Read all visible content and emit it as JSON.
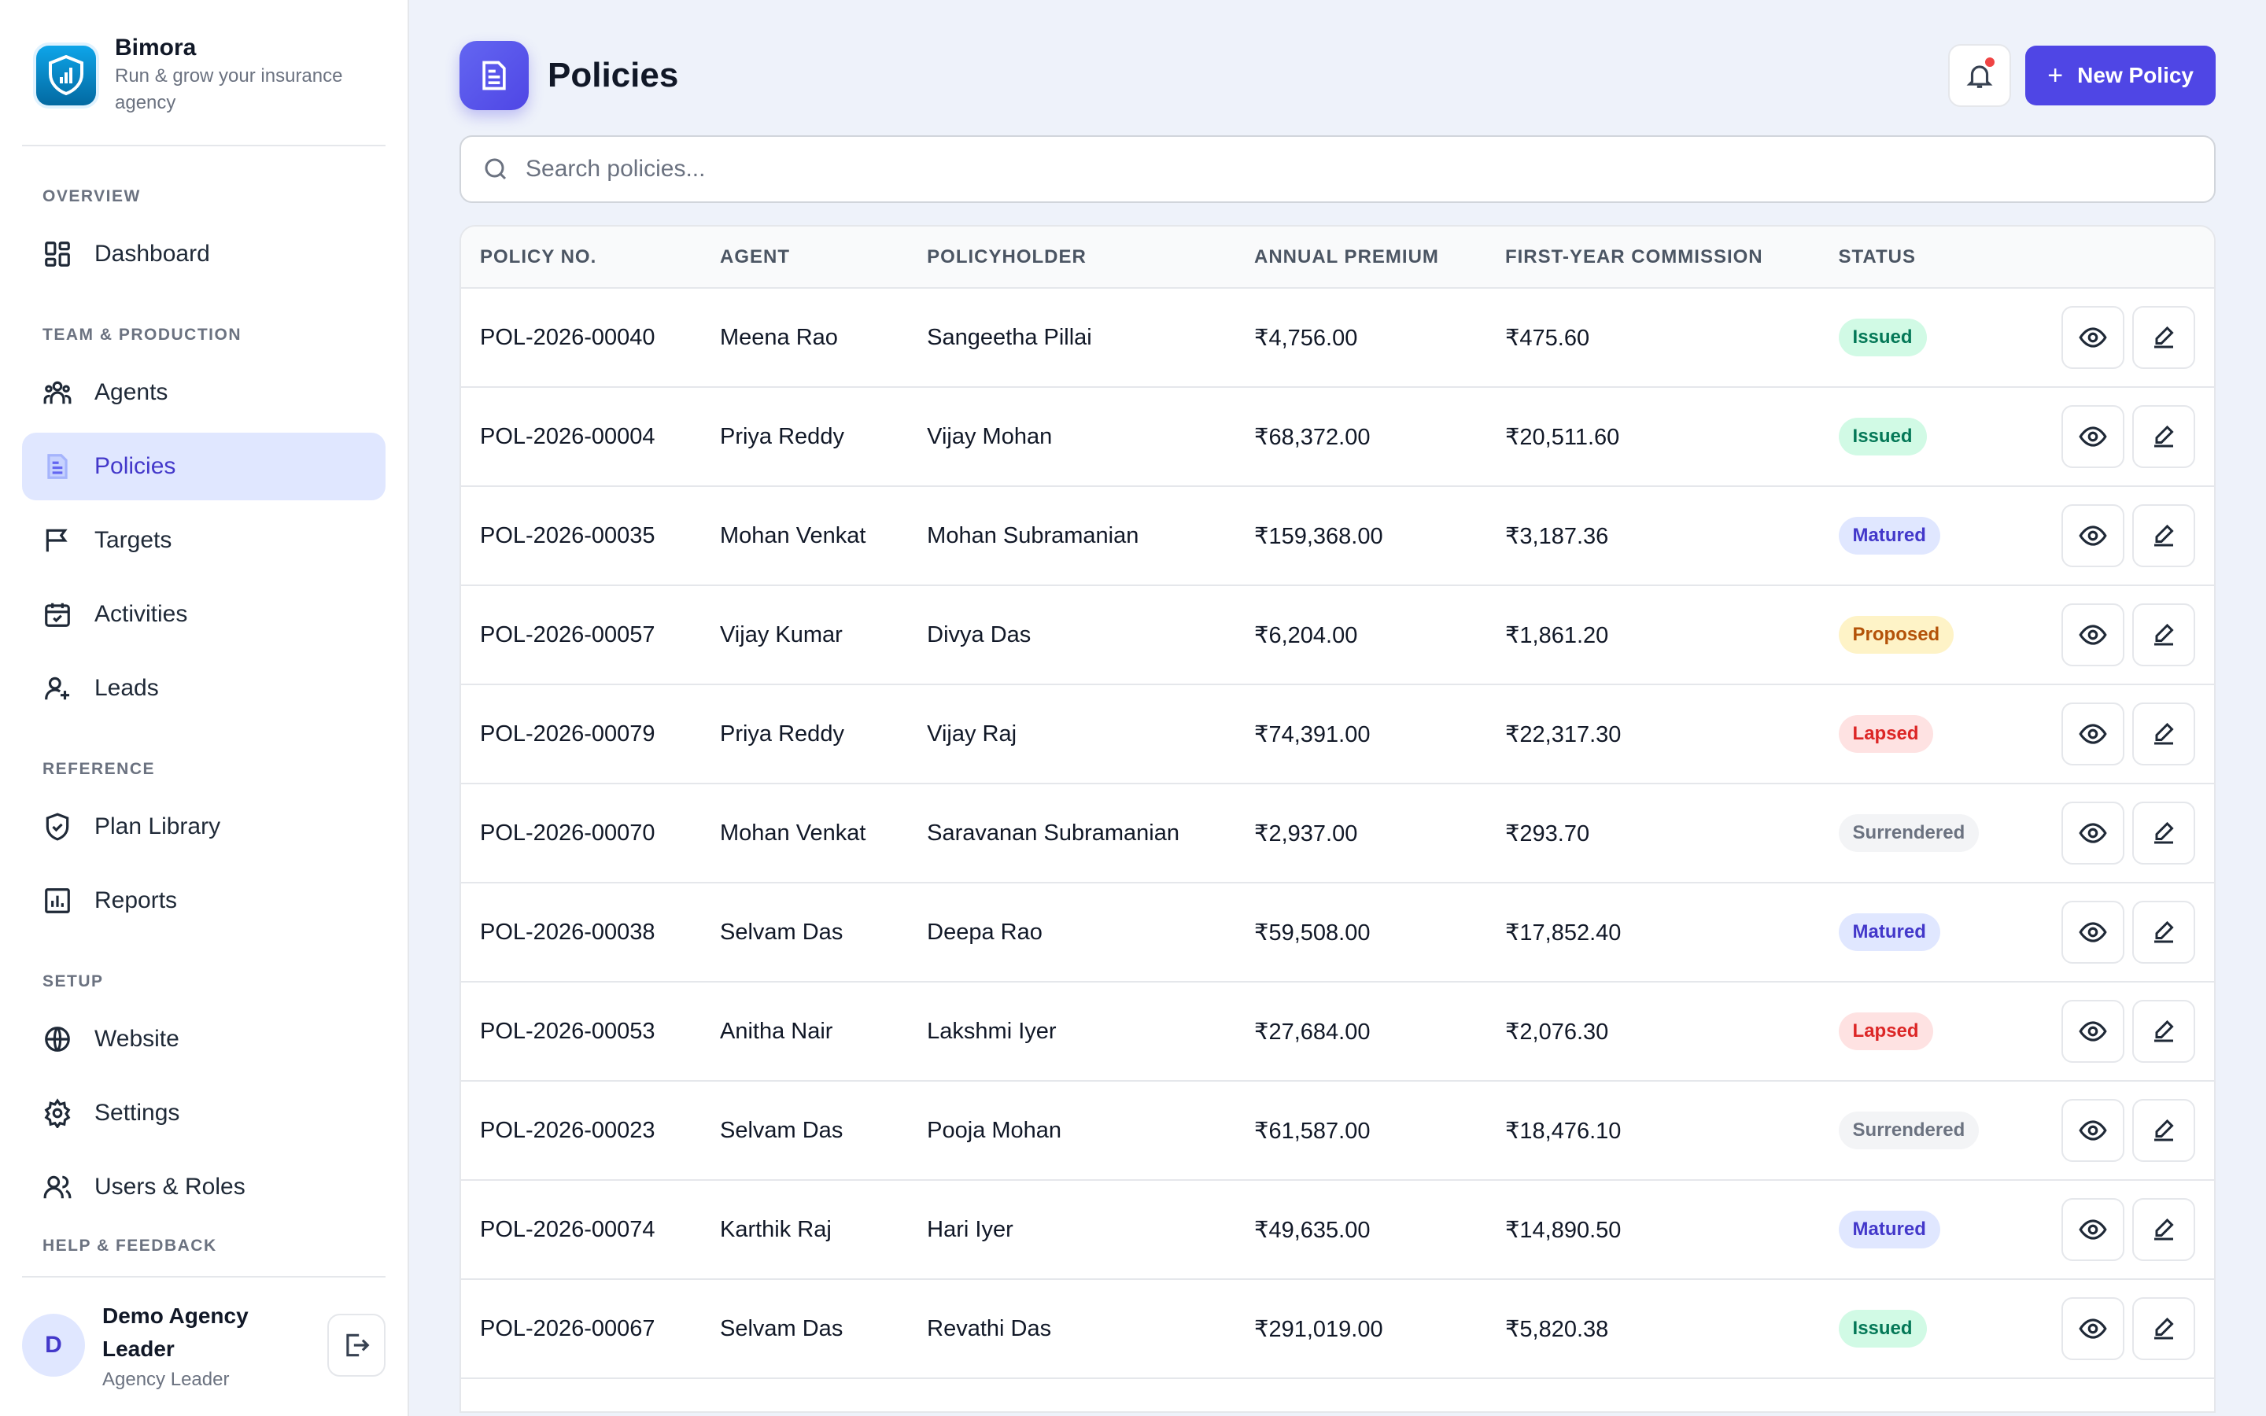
{
  "brand": {
    "name": "Bimora",
    "tagline": "Run & grow your insurance agency"
  },
  "sidebar": {
    "sections": {
      "overview": "OVERVIEW",
      "team": "TEAM & PRODUCTION",
      "reference": "REFERENCE",
      "setup": "SETUP",
      "help": "HELP & FEEDBACK"
    },
    "items": {
      "dashboard": "Dashboard",
      "agents": "Agents",
      "policies": "Policies",
      "targets": "Targets",
      "activities": "Activities",
      "leads": "Leads",
      "plan_library": "Plan Library",
      "reports": "Reports",
      "website": "Website",
      "settings": "Settings",
      "users_roles": "Users & Roles"
    },
    "active": "policies"
  },
  "user": {
    "initial": "D",
    "name": "Demo Agency Leader",
    "role": "Agency Leader"
  },
  "header": {
    "title": "Policies",
    "new_button": "New Policy"
  },
  "search": {
    "placeholder": "Search policies..."
  },
  "table": {
    "columns": [
      "POLICY NO.",
      "AGENT",
      "POLICYHOLDER",
      "ANNUAL PREMIUM",
      "FIRST-YEAR COMMISSION",
      "STATUS"
    ],
    "rows": [
      [
        "POL-2026-00040",
        "Meena Rao",
        "Sangeetha Pillai",
        "₹4,756.00",
        "₹475.60",
        "Issued"
      ],
      [
        "POL-2026-00004",
        "Priya Reddy",
        "Vijay Mohan",
        "₹68,372.00",
        "₹20,511.60",
        "Issued"
      ],
      [
        "POL-2026-00035",
        "Mohan Venkat",
        "Mohan Subramanian",
        "₹159,368.00",
        "₹3,187.36",
        "Matured"
      ],
      [
        "POL-2026-00057",
        "Vijay Kumar",
        "Divya Das",
        "₹6,204.00",
        "₹1,861.20",
        "Proposed"
      ],
      [
        "POL-2026-00079",
        "Priya Reddy",
        "Vijay Raj",
        "₹74,391.00",
        "₹22,317.30",
        "Lapsed"
      ],
      [
        "POL-2026-00070",
        "Mohan Venkat",
        "Saravanan Subramanian",
        "₹2,937.00",
        "₹293.70",
        "Surrendered"
      ],
      [
        "POL-2026-00038",
        "Selvam Das",
        "Deepa Rao",
        "₹59,508.00",
        "₹17,852.40",
        "Matured"
      ],
      [
        "POL-2026-00053",
        "Anitha Nair",
        "Lakshmi Iyer",
        "₹27,684.00",
        "₹2,076.30",
        "Lapsed"
      ],
      [
        "POL-2026-00023",
        "Selvam Das",
        "Pooja Mohan",
        "₹61,587.00",
        "₹18,476.10",
        "Surrendered"
      ],
      [
        "POL-2026-00074",
        "Karthik Raj",
        "Hari Iyer",
        "₹49,635.00",
        "₹14,890.50",
        "Matured"
      ],
      [
        "POL-2026-00067",
        "Selvam Das",
        "Revathi Das",
        "₹291,019.00",
        "₹5,820.38",
        "Issued"
      ]
    ]
  },
  "status_colors": {
    "Issued": {
      "bg": "#d1fae5",
      "fg": "#047857"
    },
    "Matured": {
      "bg": "#e0e7ff",
      "fg": "#4338ca"
    },
    "Proposed": {
      "bg": "#fef3c7",
      "fg": "#b45309"
    },
    "Lapsed": {
      "bg": "#fee2e2",
      "fg": "#dc2626"
    },
    "Surrendered": {
      "bg": "#f3f4f6",
      "fg": "#6b7280"
    }
  },
  "colors": {
    "accent": "#4f46e5",
    "active_bg": "#e0e7ff",
    "notification": "#ef4444"
  }
}
